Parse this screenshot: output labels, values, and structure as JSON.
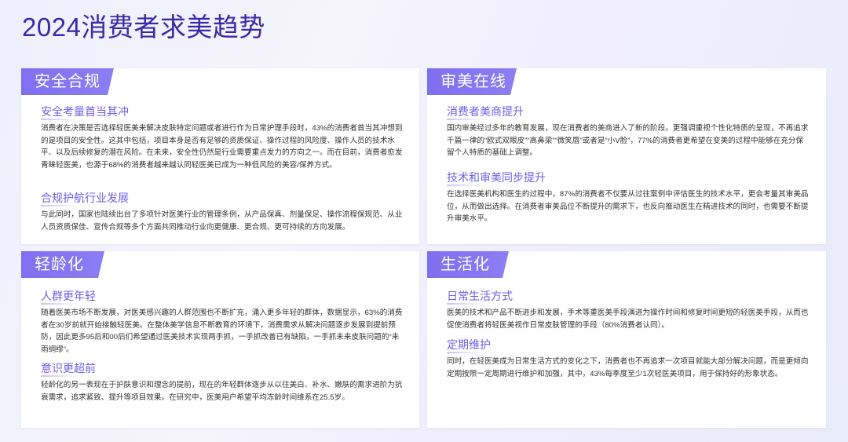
{
  "page_title": "2024消费者求美趋势",
  "cards": [
    {
      "title": "安全合规",
      "sections": [
        {
          "title": "安全考量首当其冲",
          "body": "消费者在决策是否选择轻医美来解决皮肤特定问题或者进行作为日常护理手段时，43%的消费者首当其冲想到的是项目的安全性。这其中包括，项目本身是否有足够的资质保证、操作过程的风险度、操作人员的技术水平、以及后续修复的潜在风险。在未来，安全性仍然是行业需要重点发力的方向之一。而在目前，消费者愈发青睐轻医美，也源于68%的消费者越来越认同轻医美已成为一种低风险的美容/保养方式。"
        },
        {
          "title": "合规护航行业发展",
          "body": "与此同时，国家也陆续出台了多项针对医美行业的管理条例，从产品保真、剂量保足、操作流程保规范、从业人员资质保佳、宣传合规等多个方面共同推动行业向更健康、更合规、更可持续的方向发展。"
        }
      ]
    },
    {
      "title": "审美在线",
      "sections": [
        {
          "title": "消费者美商提升",
          "body": "国内审美经过多年的教育发展，现在消费者的美商进入了新的阶段。更强调重视个性化特质的呈现，不再追求千篇一律的“欧式双眼皮”“高鼻梁”“微笑唇”或者是“小V脸”，77%的消费者更希望在变美的过程中能够在充分保留个人特质的基础上调整。"
        },
        {
          "title": "技术和审美同步提升",
          "body": "在选择医美机构和医生的过程中，87%的消费者不仅要从过往案例中评估医生的技术水平，更会考量其审美品位，从而做出选择。在消费者审美品位不断提升的需求下，也反向推动医生在精进技术的同时，也需要不断提升审美水平。"
        }
      ]
    },
    {
      "title": "轻龄化",
      "sections": [
        {
          "title": "人群更年轻",
          "body": "随着医美市场不断发展，对医美感兴趣的人群范围也不断扩充，涌入更多年轻的群体，数据显示，63%的消费者在30岁前就开始接触轻医美。在整体美学信息不断教育的环境下，消费需求从解决问题逐步发展到提前预防，因此更多95后和00后们希望通过医美技术实现两手抓，一手抓改善已有缺陷，一手抓未来皮肤问题的“未雨绸缪”。"
        },
        {
          "title": "意识更超前",
          "body": "轻龄化的另一表现在于护肤意识和理念的提前，现在的年轻群体逐步从以往美白、补水、嫩肤的需求进阶为抗衰需求，追求紧致、提升等项目效果。在研究中，医美用户希望平均冻龄时间维系在25.5岁。"
        }
      ]
    },
    {
      "title": "生活化",
      "sections": [
        {
          "title": "日常生活方式",
          "body": "医美的技术和产品不断进步和发展，手术等重医美手段演进为操作时间和修复时间更短的轻医美手段，从而也促使消费者将轻医美视作日常皮肤管理的手段（80%消费者认同）。"
        },
        {
          "title": "定期维护",
          "body": "同时，在轻医美成为日常生活方式的变化之下，消费者也不再追求一次项目就能大部分解决问题，而是更倾向定期按照一定周期进行维护和加强，其中，43%每季度至少1次轻医美项目，用于保持好的形象状态。"
        }
      ]
    }
  ]
}
